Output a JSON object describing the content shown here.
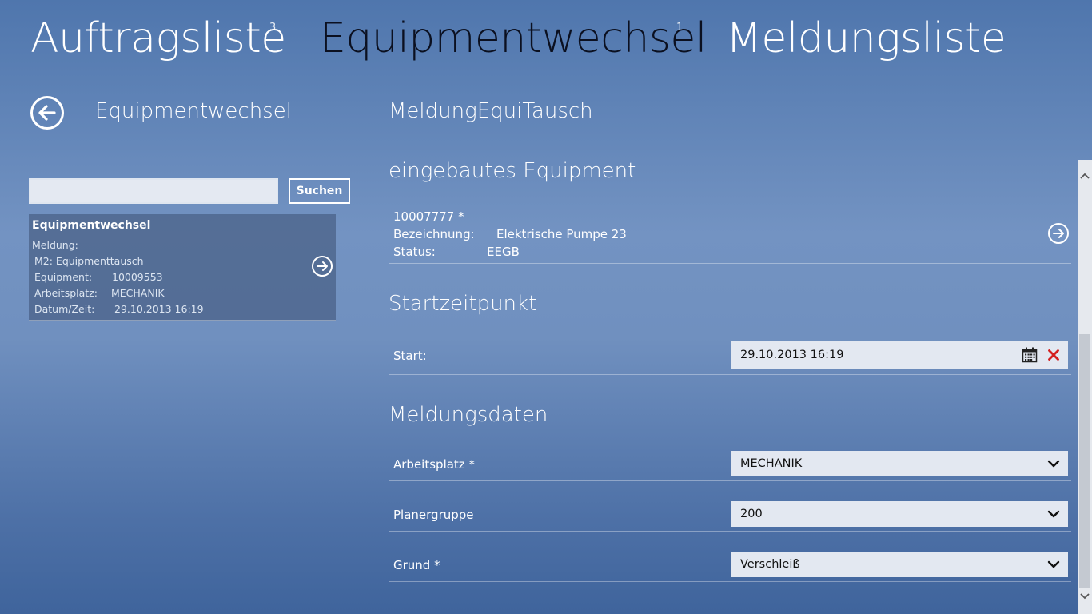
{
  "hub": {
    "tabs": [
      {
        "label": "Auftragsliste",
        "count": "3"
      },
      {
        "label": "Equipmentwechsel",
        "count": "1"
      },
      {
        "label": "Meldungsliste",
        "count": ""
      }
    ]
  },
  "left": {
    "title": "Equipmentwechsel",
    "search": {
      "value": "",
      "button_label": "Suchen"
    },
    "card": {
      "title": "Equipmentwechsel",
      "meldung_label": "Meldung:",
      "meldung_value": "M2: Equipmenttausch",
      "equipment_label": "Equipment:",
      "equipment_value": "10009553",
      "arbeitsplatz_label": "Arbeitsplatz:",
      "arbeitsplatz_value": "MECHANIK",
      "datum_label": "Datum/Zeit:",
      "datum_value": "29.10.2013 16:19"
    }
  },
  "detail": {
    "title": "MeldungEquiTausch",
    "equipment_section": {
      "heading": "eingebautes Equipment",
      "id": "10007777 *",
      "bezeichnung_label": "Bezeichnung:",
      "bezeichnung_value": "Elektrische Pumpe 23",
      "status_label": "Status:",
      "status_value": "EEGB"
    },
    "start_section": {
      "heading": "Startzeitpunkt",
      "start_label": "Start:",
      "start_value": "29.10.2013 16:19"
    },
    "meldung_section": {
      "heading": "Meldungsdaten",
      "arbeitsplatz_label": "Arbeitsplatz *",
      "arbeitsplatz_value": "MECHANIK",
      "planergruppe_label": "Planergruppe",
      "planergruppe_value": "200",
      "grund_label": "Grund *",
      "grund_value": "Verschleiß"
    }
  },
  "colors": {
    "active_tab": "#0b1020",
    "clear_icon": "#d42020",
    "field_bg": "#e3e8f1"
  }
}
